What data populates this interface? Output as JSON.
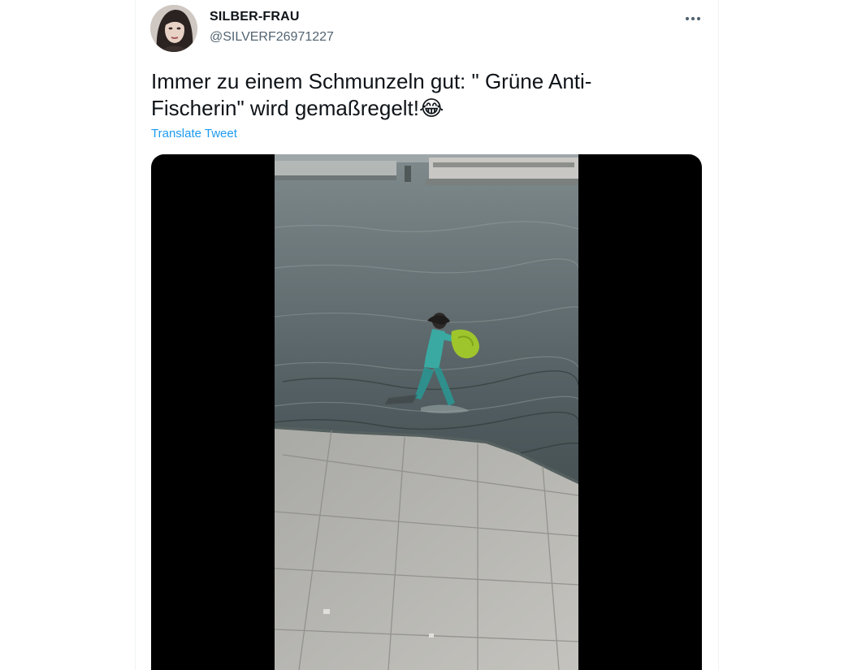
{
  "tweet": {
    "author": {
      "display_name": "SILBER-FRAU",
      "handle": "@SILVERF26971227"
    },
    "text": "Immer zu einem Schmunzeln gut: \" Grüne Anti-\nFischerin\" wird gemaßregelt!",
    "emoji": "😂",
    "translate_label": "Translate Tweet",
    "more_icon": "more-horizontal-icon",
    "media": {
      "type": "video"
    }
  },
  "colors": {
    "text_primary": "#0f1419",
    "text_secondary": "#536471",
    "link": "#1d9bf0",
    "border": "#eff3f4",
    "media_background": "#000000"
  }
}
